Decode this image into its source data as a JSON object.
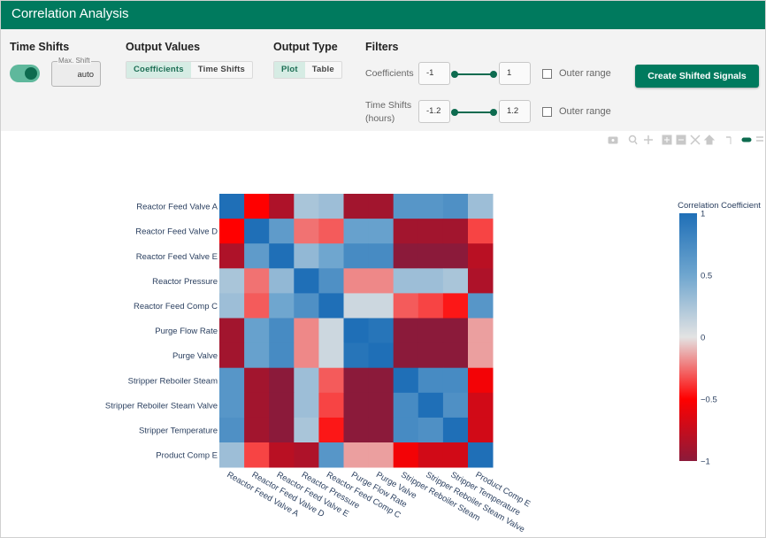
{
  "app": {
    "title": "Correlation Analysis"
  },
  "time_shifts": {
    "title": "Time Shifts",
    "toggle_on": true,
    "max_shift_legend": "Max. Shift",
    "max_shift_value": "auto"
  },
  "output_values": {
    "title": "Output Values",
    "options": [
      "Coefficients",
      "Time Shifts"
    ],
    "selected": "Coefficients"
  },
  "output_type": {
    "title": "Output Type",
    "options": [
      "Plot",
      "Table"
    ],
    "selected": "Plot"
  },
  "filters": {
    "title": "Filters",
    "coefficients": {
      "label": "Coefficients",
      "min": "-1",
      "max": "1",
      "outer_range_label": "Outer range",
      "outer_range_checked": false
    },
    "time_shifts": {
      "label_line1": "Time Shifts",
      "label_line2": "(hours)",
      "min": "-1.2",
      "max": "1.2",
      "outer_range_label": "Outer range",
      "outer_range_checked": false
    }
  },
  "create_button_label": "Create Shifted Signals",
  "modebar_icons": [
    "camera-icon",
    "zoom-icon",
    "pan-icon",
    "zoom-in-icon",
    "zoom-out-icon",
    "autoscale-icon",
    "home-icon",
    "spike-icon",
    "compare-icon",
    "closest-icon"
  ],
  "colors": {
    "accent": "#007a5e",
    "dark_green": "#0d6b4f",
    "toggle_track": "#5fb89c"
  },
  "chart_data": {
    "type": "heatmap",
    "labels": [
      "Reactor Feed Valve A",
      "Reactor Feed Valve D",
      "Reactor Feed Valve E",
      "Reactor Pressure",
      "Reactor Feed Comp C",
      "Purge Flow Rate",
      "Purge Valve",
      "Stripper Reboiler Steam",
      "Stripper Reboiler Steam Valve",
      "Stripper Temperature",
      "Product Comp E"
    ],
    "z": [
      [
        1.0,
        -0.5,
        -0.85,
        0.25,
        0.3,
        -0.9,
        -0.9,
        0.65,
        0.65,
        0.7,
        0.3
      ],
      [
        -0.5,
        1.0,
        0.6,
        -0.25,
        -0.3,
        0.55,
        0.55,
        -0.9,
        -0.9,
        -0.9,
        -0.35
      ],
      [
        -0.85,
        0.6,
        1.0,
        0.35,
        0.5,
        0.75,
        0.75,
        -1.0,
        -1.0,
        -1.0,
        -0.8
      ],
      [
        0.25,
        -0.25,
        0.35,
        1.0,
        0.7,
        -0.2,
        -0.2,
        0.3,
        0.3,
        0.25,
        -0.85
      ],
      [
        0.3,
        -0.3,
        0.5,
        0.7,
        1.0,
        0.1,
        0.1,
        -0.3,
        -0.35,
        -0.45,
        0.65
      ],
      [
        -0.9,
        0.55,
        0.75,
        -0.2,
        0.1,
        1.0,
        0.95,
        -1.0,
        -1.0,
        -1.0,
        -0.15
      ],
      [
        -0.9,
        0.55,
        0.75,
        -0.2,
        0.1,
        0.95,
        1.0,
        -1.0,
        -1.0,
        -1.0,
        -0.15
      ],
      [
        0.65,
        -0.9,
        -1.0,
        0.3,
        -0.3,
        -1.0,
        -1.0,
        1.0,
        0.75,
        0.75,
        -0.55
      ],
      [
        0.65,
        -0.9,
        -1.0,
        0.3,
        -0.35,
        -1.0,
        -1.0,
        0.75,
        1.0,
        0.7,
        -0.7
      ],
      [
        0.7,
        -0.9,
        -1.0,
        0.25,
        -0.45,
        -1.0,
        -1.0,
        0.75,
        0.7,
        1.0,
        -0.7
      ],
      [
        0.3,
        -0.35,
        -0.8,
        -0.85,
        0.65,
        -0.15,
        -0.15,
        -0.55,
        -0.7,
        -0.7,
        1.0
      ]
    ],
    "zlim": [
      -1,
      1
    ],
    "colorbar_title": "Correlation Coefficient",
    "colorbar_ticks": [
      1,
      0.5,
      0,
      -0.5,
      -1
    ],
    "colorbar_tick_labels": [
      "1",
      "0.5",
      "0",
      "−0.5",
      "−1"
    ],
    "colorscale": [
      [
        0,
        "#8b1a3a"
      ],
      [
        0.25,
        "#ff0000"
      ],
      [
        0.5,
        "#e3e3e3"
      ],
      [
        0.75,
        "#6fa6cf"
      ],
      [
        1,
        "#1f6fb7"
      ]
    ]
  }
}
